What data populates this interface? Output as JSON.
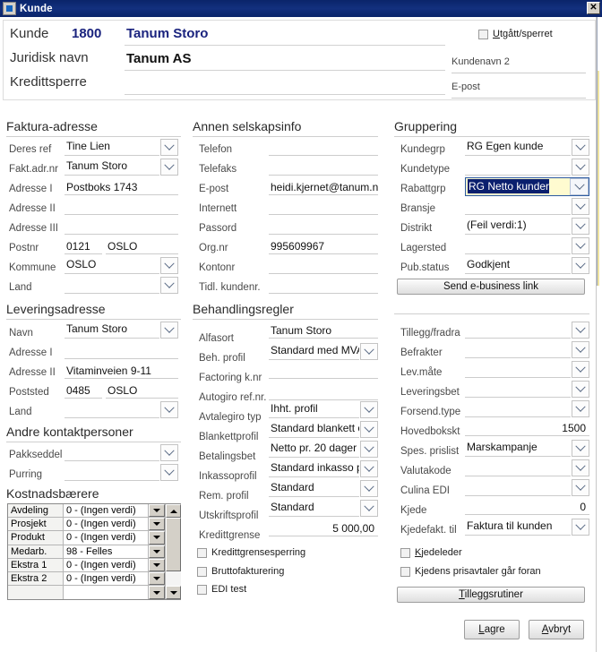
{
  "window": {
    "title": "Kunde",
    "icon": "window-app-icon",
    "close_label": "✕"
  },
  "header": {
    "kunde_label": "Kunde",
    "kunde_number": "1800",
    "kunde_name": "Tanum Storo",
    "juridisk_label": "Juridisk navn",
    "juridisk_value": "Tanum AS",
    "kredittsperre_label": "Kredittsperre",
    "kredittsperre_value": "",
    "kundenavn2_label": "Kundenavn 2",
    "kundenavn2_value": "",
    "epost_label": "E-post",
    "epost_value": "",
    "utgatt_label": "Utgått/sperret",
    "utgatt_checked": false
  },
  "faktura_adresse": {
    "title": "Faktura-adresse",
    "fields": [
      {
        "label": "Deres ref",
        "value": "Tine Lien",
        "type": "combo"
      },
      {
        "label": "Fakt.adr.nr",
        "value": "Tanum Storo",
        "type": "combo"
      },
      {
        "label": "Adresse I",
        "value": "Postboks 1743",
        "type": "text"
      },
      {
        "label": "Adresse II",
        "value": "",
        "type": "text"
      },
      {
        "label": "Adresse III",
        "value": "",
        "type": "text"
      },
      {
        "label": "Postnr",
        "value": "0121",
        "value2": "OSLO",
        "type": "split"
      },
      {
        "label": "Kommune",
        "value": "OSLO",
        "type": "combo"
      },
      {
        "label": "Land",
        "value": "",
        "type": "combo"
      }
    ]
  },
  "leveringsadresse": {
    "title": "Leveringsadresse",
    "fields": [
      {
        "label": "Navn",
        "value": "Tanum Storo",
        "type": "combo"
      },
      {
        "label": "Adresse I",
        "value": "",
        "type": "text"
      },
      {
        "label": "Adresse II",
        "value": "Vitaminveien 9-11",
        "type": "text"
      },
      {
        "label": "Poststed",
        "value": "0485",
        "value2": "OSLO",
        "type": "split"
      },
      {
        "label": "Land",
        "value": "",
        "type": "combo"
      }
    ]
  },
  "andre_kontaktpersoner": {
    "title": "Andre kontaktpersoner",
    "fields": [
      {
        "label": "Pakkseddel",
        "value": "",
        "type": "combo"
      },
      {
        "label": "Purring",
        "value": "",
        "type": "combo"
      }
    ]
  },
  "kostnadsbaerere": {
    "title": "Kostnadsbærere",
    "rows": [
      {
        "name": "Avdeling",
        "value": "0 - (Ingen verdi)"
      },
      {
        "name": "Prosjekt",
        "value": "0 - (Ingen verdi)"
      },
      {
        "name": "Produkt",
        "value": "0 - (Ingen verdi)"
      },
      {
        "name": "Medarb.",
        "value": "98 - Felles"
      },
      {
        "name": "Ekstra 1",
        "value": "0 - (Ingen verdi)"
      },
      {
        "name": "Ekstra 2",
        "value": "0 - (Ingen verdi)"
      },
      {
        "name": "",
        "value": ""
      }
    ]
  },
  "annen_selskapsinfo": {
    "title": "Annen selskapsinfo",
    "fields": [
      {
        "label": "Telefon",
        "value": ""
      },
      {
        "label": "Telefaks",
        "value": ""
      },
      {
        "label": "E-post",
        "value": "heidi.kjernet@tanum.no"
      },
      {
        "label": "Internett",
        "value": ""
      },
      {
        "label": "Passord",
        "value": ""
      },
      {
        "label": "Org.nr",
        "value": "995609967"
      },
      {
        "label": "Kontonr",
        "value": ""
      },
      {
        "label": "Tidl. kundenr.",
        "value": ""
      }
    ]
  },
  "behandlingsregler": {
    "title": "Behandlingsregler",
    "fields": [
      {
        "label": "Alfasort",
        "value": "Tanum Storo",
        "type": "text"
      },
      {
        "label": "Beh. profil",
        "value": "Standard med MVA",
        "type": "combo"
      },
      {
        "label": "Factoring k.nr",
        "value": "",
        "type": "text"
      },
      {
        "label": "Autogiro ref.nr.",
        "value": "",
        "type": "text"
      },
      {
        "label": "Avtalegiro typ",
        "value": "Ihht. profil",
        "type": "combo"
      },
      {
        "label": "Blankettprofil",
        "value": "Standard blankett op",
        "type": "combo"
      },
      {
        "label": "Betalingsbet",
        "value": "Netto pr. 20 dager",
        "type": "combo"
      },
      {
        "label": "Inkassoprofil",
        "value": "Standard inkasso pr",
        "type": "combo"
      },
      {
        "label": "Rem. profil",
        "value": "Standard",
        "type": "combo"
      },
      {
        "label": "Utskriftsprofil",
        "value": "Standard",
        "type": "combo"
      },
      {
        "label": "Kredittgrense",
        "value": "5 000,00",
        "type": "num"
      }
    ],
    "checkboxes": [
      {
        "label": "Kredittgrensesperring",
        "checked": false
      },
      {
        "label": "Bruttofakturering",
        "checked": false
      },
      {
        "label": "EDI test",
        "checked": false
      }
    ]
  },
  "gruppering": {
    "title": "Gruppering",
    "fields": [
      {
        "label": "Kundegrp",
        "value": "RG Egen kunde",
        "type": "combo"
      },
      {
        "label": "Kundetype",
        "value": "",
        "type": "combo"
      },
      {
        "label": "Rabattgrp",
        "value": "RG Netto kunder",
        "type": "combo",
        "focused": true
      },
      {
        "label": "Bransje",
        "value": "",
        "type": "combo"
      },
      {
        "label": "Distrikt",
        "value": "(Feil verdi:1)",
        "type": "combo"
      },
      {
        "label": "Lagersted",
        "value": "",
        "type": "combo"
      },
      {
        "label": "Pub.status",
        "value": "Godkjent",
        "type": "combo"
      }
    ],
    "send_button": "Send e-business link"
  },
  "logistikk": {
    "fields": [
      {
        "label": "Tillegg/fradra",
        "value": "",
        "type": "combo"
      },
      {
        "label": "Befrakter",
        "value": "",
        "type": "combo"
      },
      {
        "label": "Lev.måte",
        "value": "",
        "type": "combo"
      },
      {
        "label": "Leveringsbet",
        "value": "",
        "type": "combo"
      },
      {
        "label": "Forsend.type",
        "value": "",
        "type": "combo"
      },
      {
        "label": "Hovedbokskt",
        "value": "1500",
        "type": "num"
      },
      {
        "label": "Spes. prislist",
        "value": "Marskampanje",
        "type": "combo"
      },
      {
        "label": "Valutakode",
        "value": "",
        "type": "combo"
      },
      {
        "label": "Culina EDI",
        "value": "",
        "type": "combo"
      },
      {
        "label": "Kjede",
        "value": "0",
        "type": "num"
      },
      {
        "label": "Kjedefakt. til",
        "value": "Faktura til kunden",
        "type": "combo"
      }
    ],
    "checkboxes": [
      {
        "label": "Kjedeleder",
        "checked": false
      },
      {
        "label": "Kjedens prisavtaler går foran",
        "checked": false
      }
    ],
    "tilleggsrutiner_button": "Tilleggsrutiner"
  },
  "footer": {
    "save_label": "Lagre",
    "cancel_label": "Avbryt"
  },
  "colors": {
    "titlebar": "#0a246a",
    "accent_blue": "#1a237e",
    "focus_bg": "#fffbd0",
    "selection": "#0a1f6e"
  }
}
